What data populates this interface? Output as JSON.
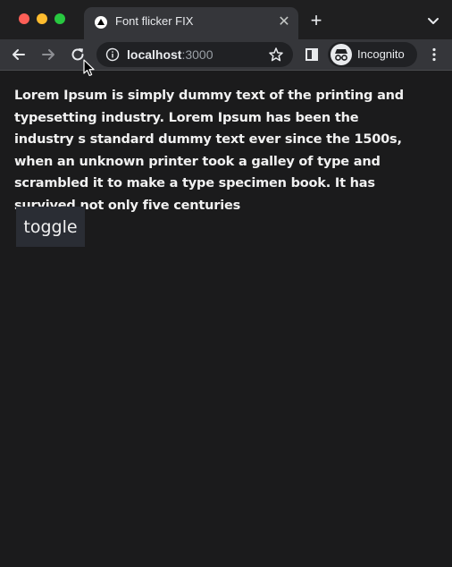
{
  "browser": {
    "tab": {
      "title": "Font flicker FIX",
      "favicon": "triangle-logo-icon",
      "close_glyph": "✕"
    },
    "new_tab_glyph": "+",
    "tab_menu_icon": "chevron-down-icon",
    "toolbar": {
      "back_icon": "arrow-left-icon",
      "forward_icon": "arrow-right-icon",
      "reload_icon": "reload-icon",
      "address": {
        "host": "localhost",
        "port": ":3000",
        "info_icon": "info-icon",
        "bookmark_icon": "star-icon"
      },
      "side_panel_icon": "side-panel-icon",
      "profile": {
        "label": "Incognito",
        "icon": "incognito-icon"
      },
      "menu_icon": "kebab-menu-icon"
    },
    "colors": {
      "traffic_red": "#fe5f57",
      "traffic_yellow": "#febc2e",
      "traffic_green": "#28c840",
      "page_background": "#1b1b1c",
      "button_background": "#2a2d34"
    }
  },
  "page": {
    "paragraph": "Lorem Ipsum is simply dummy text of the printing and typesetting industry. Lorem Ipsum has been the industry s standard dummy text ever since the 1500s, when an unknown printer took a galley of type and scrambled it to make a type specimen book. It has survived not only five centuries",
    "toggle_label": "toggle"
  }
}
